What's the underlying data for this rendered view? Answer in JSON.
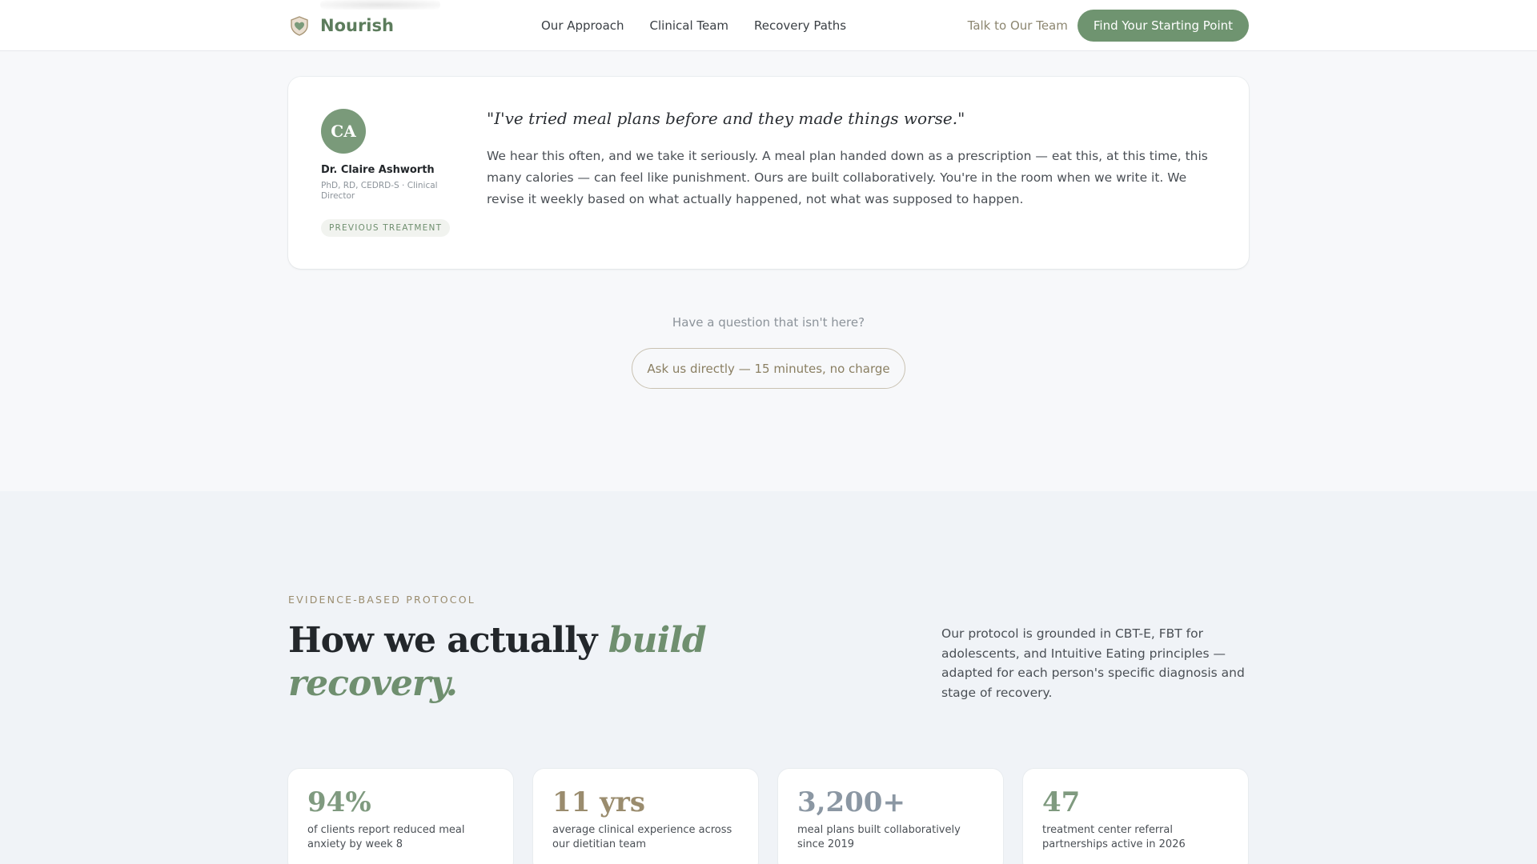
{
  "nav": {
    "brand": "Nourish",
    "links": [
      "Our Approach",
      "Clinical Team",
      "Recovery Paths"
    ],
    "talk_label": "Talk to Our Team",
    "cta_label": "Find Your Starting Point"
  },
  "qa": {
    "author": {
      "initials": "CA",
      "name": "Dr. Claire Ashworth",
      "credentials": "PhD, RD, CEDRD-S · Clinical Director",
      "tag": "PREVIOUS TREATMENT"
    },
    "question": "\"I've tried meal plans before and they made things worse.\"",
    "answer": "We hear this often, and we take it seriously. A meal plan handed down as a prescription — eat this, at this time, this many calories — can feel like punishment. Ours are built collaboratively. You're in the room when we write it. We revise it weekly based on what actually happened, not what was supposed to happen."
  },
  "ask": {
    "prompt": "Have a question that isn't here?",
    "button_label": "Ask us directly — 15 minutes, no charge"
  },
  "evidence": {
    "eyebrow": "EVIDENCE-BASED PROTOCOL",
    "headline_plain": "How we actually ",
    "headline_accent": "build recovery.",
    "lead": "Our protocol is grounded in CBT-E, FBT for adolescents, and Intuitive Eating principles — adapted for each person's specific diagnosis and stage of recovery.",
    "stats": [
      {
        "value": "94%",
        "label": "of clients report reduced meal anxiety by week 8",
        "color": "#7f9a7f"
      },
      {
        "value": "11 yrs",
        "label": "average clinical experience across our dietitian team",
        "color": "#9a8c6e"
      },
      {
        "value": "3,200+",
        "label": "meal plans built collaboratively since 2019",
        "color": "#8b97a3"
      },
      {
        "value": "47",
        "label": "treatment center referral partnerships active in 2026",
        "color": "#7f9a7f"
      }
    ]
  },
  "colors": {
    "brand_green": "#6f9470",
    "accent_gold": "#9a8c6e"
  }
}
